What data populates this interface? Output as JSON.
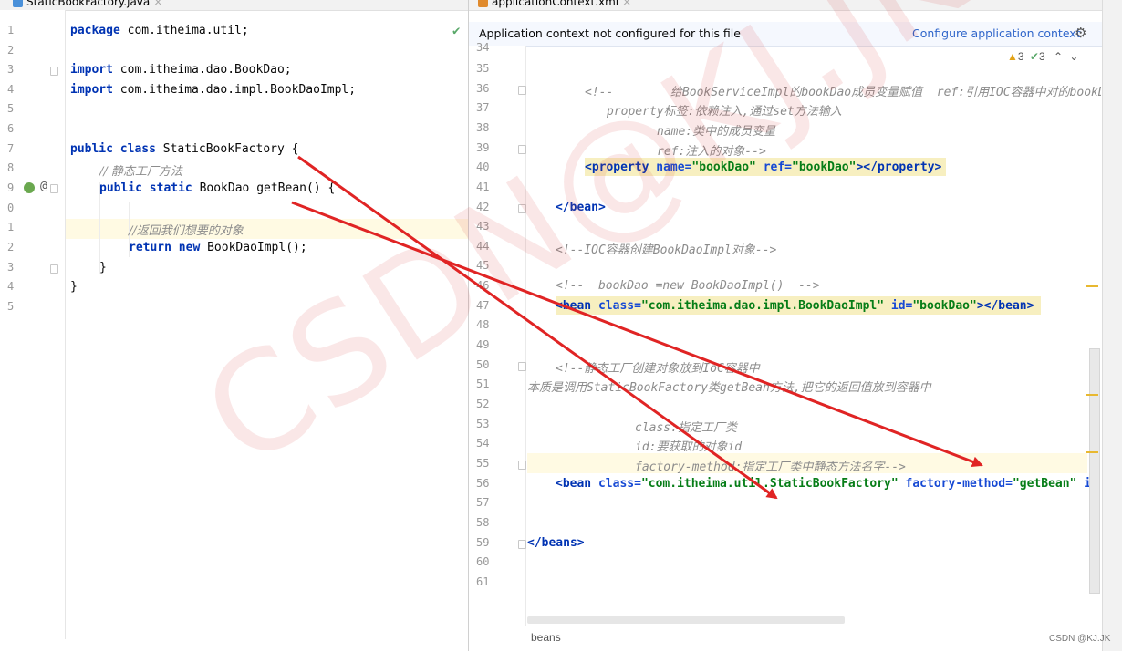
{
  "left_tab": {
    "title": "StaticBookFactory.java",
    "close": "×"
  },
  "right_tab": {
    "title": "applicationContext.xml",
    "close": "×"
  },
  "left_editor": {
    "lines": [
      "1",
      "2",
      "3",
      "4",
      "5",
      "6",
      "7",
      "8",
      "9",
      "0",
      "1",
      "2",
      "3",
      "4",
      "5"
    ],
    "package_kw": "package",
    "package_name": " com.itheima.util;",
    "import_kw": "import",
    "import1": " com.itheima.dao.BookDao;",
    "import2": " com.itheima.dao.impl.BookDaoImpl;",
    "class_kw": "public class",
    "class_name": " StaticBookFactory {",
    "comment_static": "// 静态工厂方法",
    "method_kw": "public static",
    "method_sig": " BookDao getBean() {",
    "comment_return": "//返回我们想要的对象",
    "return_kw": "return new",
    "return_expr": " BookDaoImpl();",
    "close_brace": "}",
    "close_brace_outer": "}",
    "check_mark": "✔",
    "at_sign": "@"
  },
  "right_editor": {
    "banner_text": "Application context not configured for this file",
    "banner_link": "Configure application context",
    "warnings": "3",
    "checks": "3",
    "line_numbers": [
      "34",
      "35",
      "36",
      "37",
      "38",
      "39",
      "40",
      "41",
      "42",
      "43",
      "44",
      "45",
      "46",
      "47",
      "48",
      "49",
      "50",
      "51",
      "52",
      "53",
      "54",
      "55",
      "56",
      "57",
      "58",
      "59",
      "60",
      "61"
    ],
    "l36": "<!--        给BookServiceImpl的bookDao成员变量赋值  ref:引用IOC容器中对的bookD",
    "l37": "property标签:依赖注入,通过set方法输入",
    "l38": "name:类中的成员变量",
    "l39": "ref:注入的对象-->",
    "l40_open": "<property",
    "l40_attr1": " name=",
    "l40_val1": "\"bookDao\"",
    "l40_attr2": " ref=",
    "l40_val2": "\"bookDao\"",
    "l40_close": "></property>",
    "l42": "</bean>",
    "l44": "<!--IOC容器创建BookDaoImpl对象-->",
    "l46": "<!--  bookDao =new BookDaoImpl()  -->",
    "l47_open": "<bean",
    "l47_attr1": " class=",
    "l47_val1": "\"com.itheima.dao.impl.BookDaoImpl\"",
    "l47_attr2": " id=",
    "l47_val2": "\"bookDao\"",
    "l47_close": "></bean>",
    "l50": "<!--静态工厂创建对象放到IoC容器中",
    "l51": "本质是调用StaticBookFactory类getBean方法,把它的返回值放到容器中",
    "l53": "class:指定工厂类",
    "l54": "id:要获取的对象id",
    "l55": "factory-method:指定工厂类中静态方法名字-->",
    "l56_open": "<bean",
    "l56_attr1": " class=",
    "l56_val1": "\"com.itheima.util.StaticBookFactory\"",
    "l56_attr2": " factory-method=",
    "l56_val2": "\"getBean\"",
    "l56_rest": " i",
    "l59": "</beans>",
    "breadcrumb": "beans"
  },
  "watermark": "CSDN@KJ.JK",
  "footer_credit": "CSDN @KJ.JK",
  "colors": {
    "keyword": "#0033b3",
    "string": "#067d17",
    "comment": "#8c8c8c",
    "arrow": "#e02424",
    "highlight": "#fffae3"
  }
}
